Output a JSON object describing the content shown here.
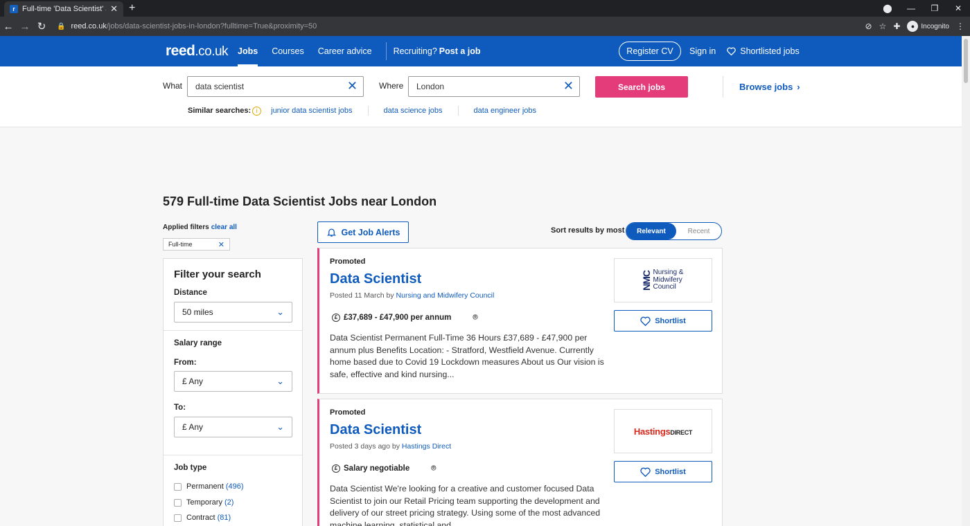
{
  "browser": {
    "tab_title": "Full-time 'Data Scientist' Jobs | L...",
    "tab_favicon": "r",
    "url_host": "reed.co.uk",
    "url_path": "/jobs/data-scientist-jobs-in-london?fulltime=True&proximity=50",
    "profile_label": "Incognito"
  },
  "header": {
    "logo_main": "reed",
    "logo_tld": ".co.uk",
    "nav": [
      "Jobs",
      "Courses",
      "Career advice"
    ],
    "recruiting_text": "Recruiting?",
    "post_job": "Post a job",
    "register_cv": "Register CV",
    "sign_in": "Sign in",
    "shortlisted": "Shortlisted jobs"
  },
  "search": {
    "what_label": "What",
    "what_value": "data scientist",
    "where_label": "Where",
    "where_value": "London",
    "search_button": "Search jobs",
    "browse_jobs": "Browse jobs",
    "similar_label": "Similar searches:",
    "similar": [
      "junior data scientist jobs",
      "data science jobs",
      "data engineer jobs"
    ]
  },
  "results": {
    "title": "579 Full-time Data Scientist Jobs near London",
    "applied_filters_label": "Applied filters",
    "clear_all": "clear all",
    "filter_chip": "Full-time",
    "get_alerts": "Get Job Alerts",
    "sort_label": "Sort results by most",
    "sort_relevant": "Relevant",
    "sort_recent": "Recent"
  },
  "filters": {
    "title": "Filter your search",
    "distance_label": "Distance",
    "distance_value": "50 miles",
    "salary_label": "Salary range",
    "from_label": "From:",
    "from_value": "£ Any",
    "to_label": "To:",
    "to_value": "£ Any",
    "job_type_label": "Job type",
    "job_types": [
      {
        "label": "Permanent",
        "count": "(496)"
      },
      {
        "label": "Temporary",
        "count": "(2)"
      },
      {
        "label": "Contract",
        "count": "(81)"
      }
    ]
  },
  "jobs": [
    {
      "promoted": "Promoted",
      "title": "Data Scientist",
      "posted_prefix": "Posted 11 March by",
      "company": "Nursing and Midwifery Council",
      "salary": "£37,689 - £47,900 per annum",
      "description": "Data Scientist   Permanent Full-Time 36 Hours £37,689 - £47,900 per annum plus Benefits Location:  - Stratford, Westfield Avenue. Currently home based due to Covid 19 Lockdown measures About us Our vision is safe, effective and kind nursing...",
      "logo_mark": "NMC",
      "logo_lines": [
        "Nursing &",
        "Midwifery",
        "Council"
      ],
      "shortlist": "Shortlist"
    },
    {
      "promoted": "Promoted",
      "title": "Data Scientist",
      "posted_prefix": "Posted 3 days ago by",
      "company": "Hastings Direct",
      "salary": "Salary negotiable",
      "description": "Data Scientist We're looking for a creative and customer focused Data Scientist to join our Retail Pricing team supporting the development and delivery of our street pricing strategy. Using some of the most advanced machine learning, statistical and...",
      "logo_main": "Hastings",
      "logo_sub": "DIRECT",
      "shortlist": "Shortlist"
    }
  ],
  "colors": {
    "brand_blue": "#0f5bbd",
    "accent_pink": "#e43b7a"
  }
}
